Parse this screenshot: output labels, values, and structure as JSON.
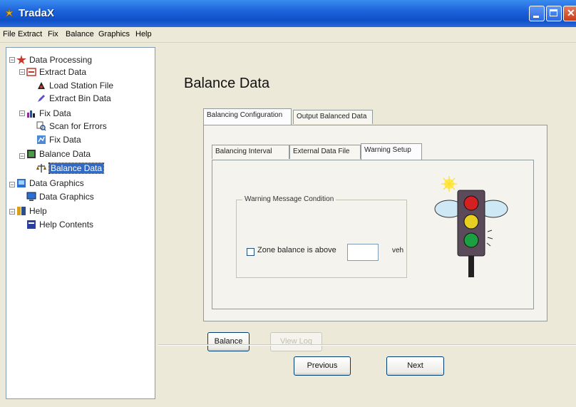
{
  "window": {
    "title": "TradaX"
  },
  "menu": [
    "File",
    "Extract",
    "Fix",
    "Balance",
    "Graphics",
    "Help"
  ],
  "tree": {
    "data_processing": "Data Processing",
    "extract_data": "Extract Data",
    "load_station_file": "Load Station File",
    "extract_bin_data": "Extract Bin Data",
    "fix_data": "Fix Data",
    "scan_for_errors": "Scan for Errors",
    "fix_data_item": "Fix Data",
    "balance_data": "Balance Data",
    "balance_data_item": "Balance Data",
    "data_graphics": "Data Graphics",
    "data_graphics_item": "Data Graphics",
    "help": "Help",
    "help_contents": "Help Contents"
  },
  "main": {
    "title": "Balance Data",
    "outer_tabs": [
      "Balancing Configuration",
      "Output Balanced Data"
    ],
    "inner_tabs": [
      "Balancing Interval",
      "External Data File",
      "Warning Setup"
    ],
    "group_title": "Warning Message Condition",
    "checkbox_label": "Zone balance is above",
    "threshold_value": "",
    "unit": "veh",
    "buttons": {
      "balance": "Balance",
      "view_log": "View Log"
    }
  },
  "footer": {
    "previous": "Previous",
    "next": "Next"
  },
  "colors": {
    "titlebar": "#1d63db",
    "selection": "#316ac5",
    "face": "#ece9d8"
  },
  "icons": [
    "app-icon",
    "traffic-light-image"
  ]
}
